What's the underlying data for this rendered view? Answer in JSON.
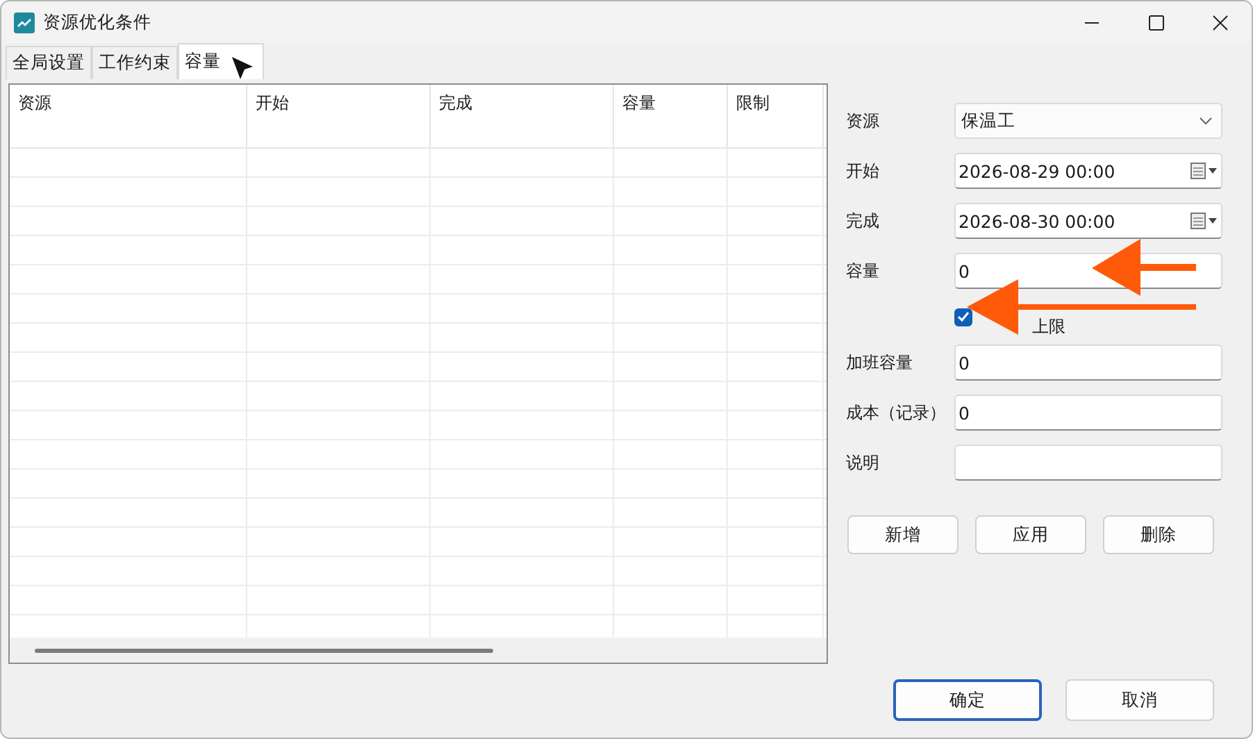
{
  "window": {
    "title": "资源优化条件"
  },
  "tabs": [
    {
      "label": "全局设置",
      "selected": false
    },
    {
      "label": "工作约束",
      "selected": false
    },
    {
      "label": "容量",
      "selected": true
    }
  ],
  "table": {
    "columns": [
      "资源",
      "开始",
      "完成",
      "容量",
      "限制"
    ]
  },
  "form": {
    "fields": [
      {
        "kind": "dropdown",
        "label": "资源",
        "value": "保温工"
      },
      {
        "kind": "date",
        "label": "开始",
        "value": "2026-08-29 00:00"
      },
      {
        "kind": "date",
        "label": "完成",
        "value": "2026-08-30 00:00"
      },
      {
        "kind": "text",
        "label": "容量",
        "value": "0"
      },
      {
        "kind": "checkbox",
        "label": "上限",
        "checked": true
      },
      {
        "kind": "text",
        "label": "加班容量",
        "value": "0"
      },
      {
        "kind": "text",
        "label": "成本（记录）",
        "value": "0"
      },
      {
        "kind": "text",
        "label": "说明"
      }
    ],
    "buttons": [
      "新增",
      "应用",
      "删除"
    ]
  },
  "footer_buttons": [
    {
      "label": "确定",
      "selected": true
    },
    {
      "label": "取消",
      "selected": false
    }
  ]
}
